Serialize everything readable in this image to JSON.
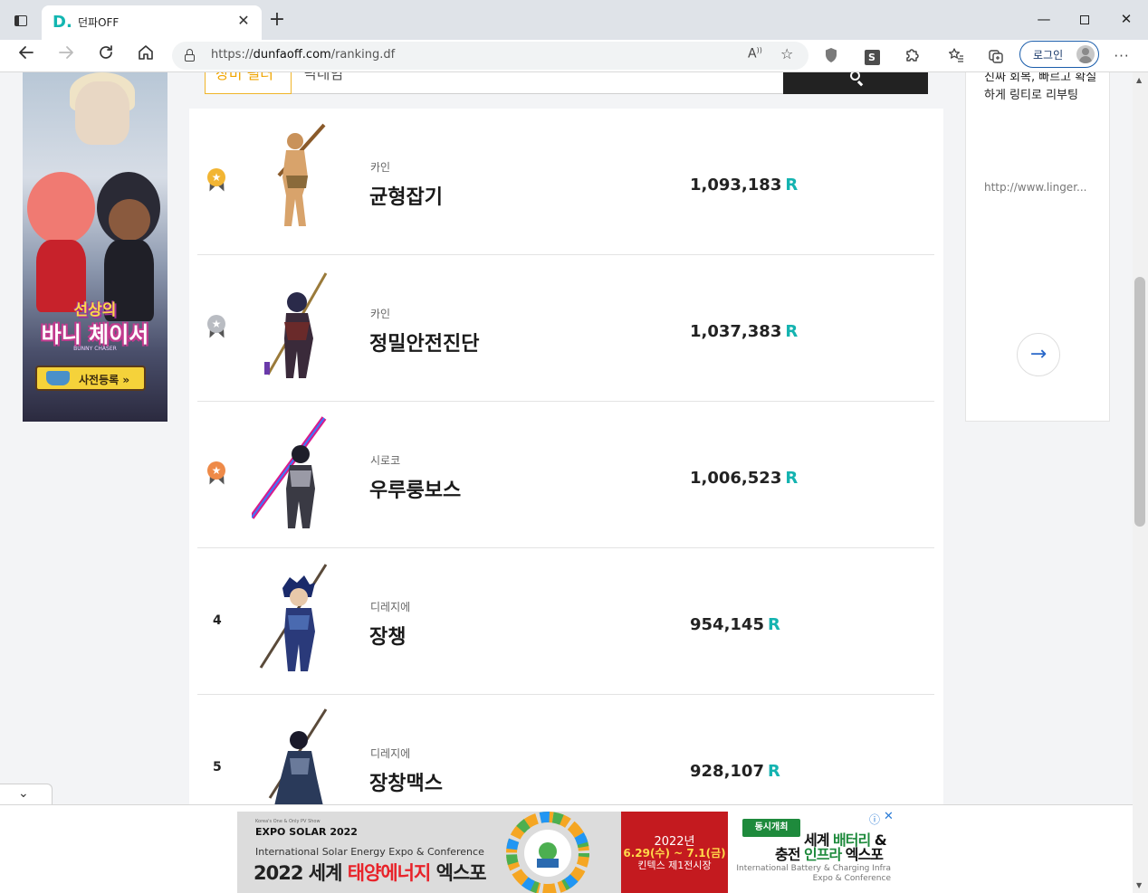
{
  "browser": {
    "tab_favicon": "D.",
    "tab_title": "던파OFF",
    "tab_close": "✕",
    "new_tab": "+",
    "url_prefix": "https://",
    "url_host": "dunfaoff.com",
    "url_path": "/ranking.df",
    "login_label": "로그인",
    "window_min": "—",
    "window_close": "✕",
    "more": "···"
  },
  "search": {
    "filter_label": "장비 필터",
    "placeholder": "닉네임"
  },
  "ranking": [
    {
      "rank": "1",
      "medal": "gold",
      "medal_color": "#f2b533",
      "server": "카인",
      "nickname": "균형잡기",
      "score": "1,093,183",
      "unit": "R"
    },
    {
      "rank": "2",
      "medal": "silver",
      "medal_color": "#b9bcc2",
      "server": "카인",
      "nickname": "정밀안전진단",
      "score": "1,037,383",
      "unit": "R"
    },
    {
      "rank": "3",
      "medal": "bronze",
      "medal_color": "#ee8a48",
      "server": "시로코",
      "nickname": "우루룽보스",
      "score": "1,006,523",
      "unit": "R"
    },
    {
      "rank": "4",
      "medal": "none",
      "server": "디레지에",
      "nickname": "장챙",
      "score": "954,145",
      "unit": "R"
    },
    {
      "rank": "5",
      "medal": "none",
      "server": "디레지에",
      "nickname": "장창맥스",
      "score": "928,107",
      "unit": "R"
    }
  ],
  "sidebar": {
    "description": "진짜 회복, 빠르고 확실하게 링티로 리부팅",
    "link": "http://www.linger...",
    "go_icon": "arrow-right-icon"
  },
  "left_ad": {
    "title_top": "선상의",
    "title_main": "바니 체이서",
    "subtitle": "BUNNY CHASER",
    "cta": "사전등록 »"
  },
  "bottom_ad": {
    "tagline": "Korea's One & Only PV Show",
    "expo_name": "EXPO SOLAR 2022",
    "expo_full": "International Solar Energy Expo & Conference",
    "headline_pre": "2022 세계 ",
    "headline_red": "태양에너지",
    "headline_post": " 엑스포",
    "year": "2022년",
    "dates": "6.29(수) ~ 7.1(금)",
    "venue": "킨텍스 제1전시장",
    "badge": "동시개최",
    "right_title_pre": "세계 ",
    "right_title_green": "배터리",
    "right_title_post": " &",
    "right_sub_pre": "충전 ",
    "right_sub_green": "인프라",
    "right_sub_post": " 엑스포",
    "right_caption": "International Battery & Charging Infra Expo & Conference"
  },
  "colors": {
    "accent_teal": "#14b3b0",
    "filter_orange": "#f0a500",
    "search_btn": "#222222",
    "link_blue": "#2a68c9"
  }
}
